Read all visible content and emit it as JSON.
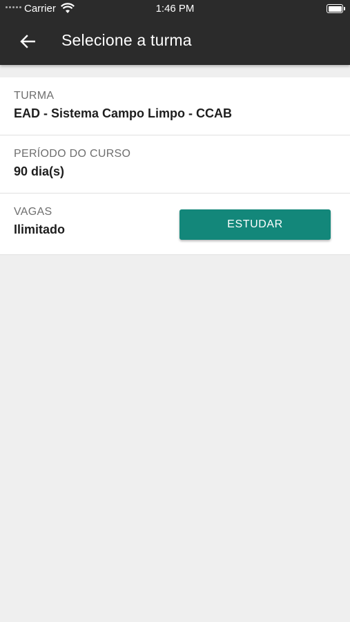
{
  "status_bar": {
    "carrier": "Carrier",
    "time": "1:46 PM",
    "icons": [
      "signal-dots-icon",
      "wifi-icon",
      "battery-icon"
    ]
  },
  "toolbar": {
    "back_icon": "arrow-left-icon",
    "title": "Selecione a turma"
  },
  "details": {
    "turma": {
      "label": "TURMA",
      "value": "EAD - Sistema Campo Limpo - CCAB"
    },
    "periodo": {
      "label": "PERÍODO DO CURSO",
      "value": "90 dia(s)"
    },
    "vagas": {
      "label": "VAGAS",
      "value": "Ilimitado"
    }
  },
  "actions": {
    "study_label": "ESTUDAR"
  },
  "colors": {
    "toolbar": "#2b2b2b",
    "accent": "#13877a",
    "background": "#efefef"
  }
}
